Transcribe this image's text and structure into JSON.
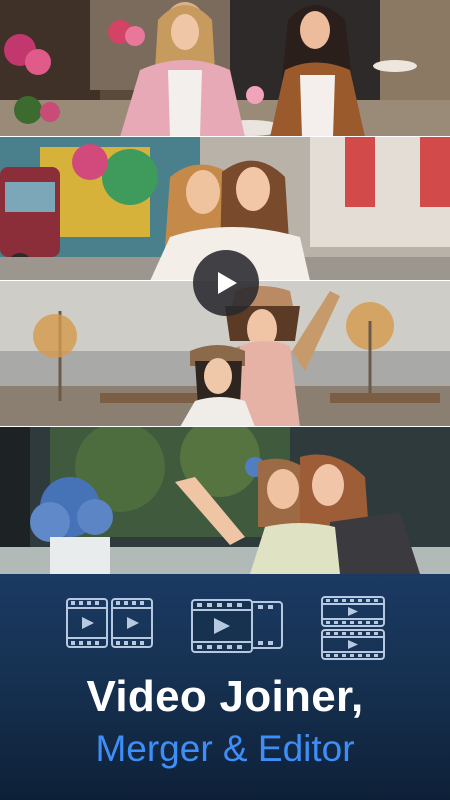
{
  "promo": {
    "title_line1": "Video Joiner,",
    "title_line2": "Merger & Editor",
    "title_color": "#ffffff",
    "subtitle_color": "#3f8ef7",
    "background_color": "#15304f"
  },
  "icons": {
    "play": "play-icon",
    "features": [
      "video-join-icon",
      "video-merge-icon",
      "video-stack-icon"
    ]
  },
  "photos": [
    "cafe-terrace-photo",
    "carnival-hug-photo",
    "lakeside-selfie-photo",
    "indoor-flowers-photo"
  ]
}
